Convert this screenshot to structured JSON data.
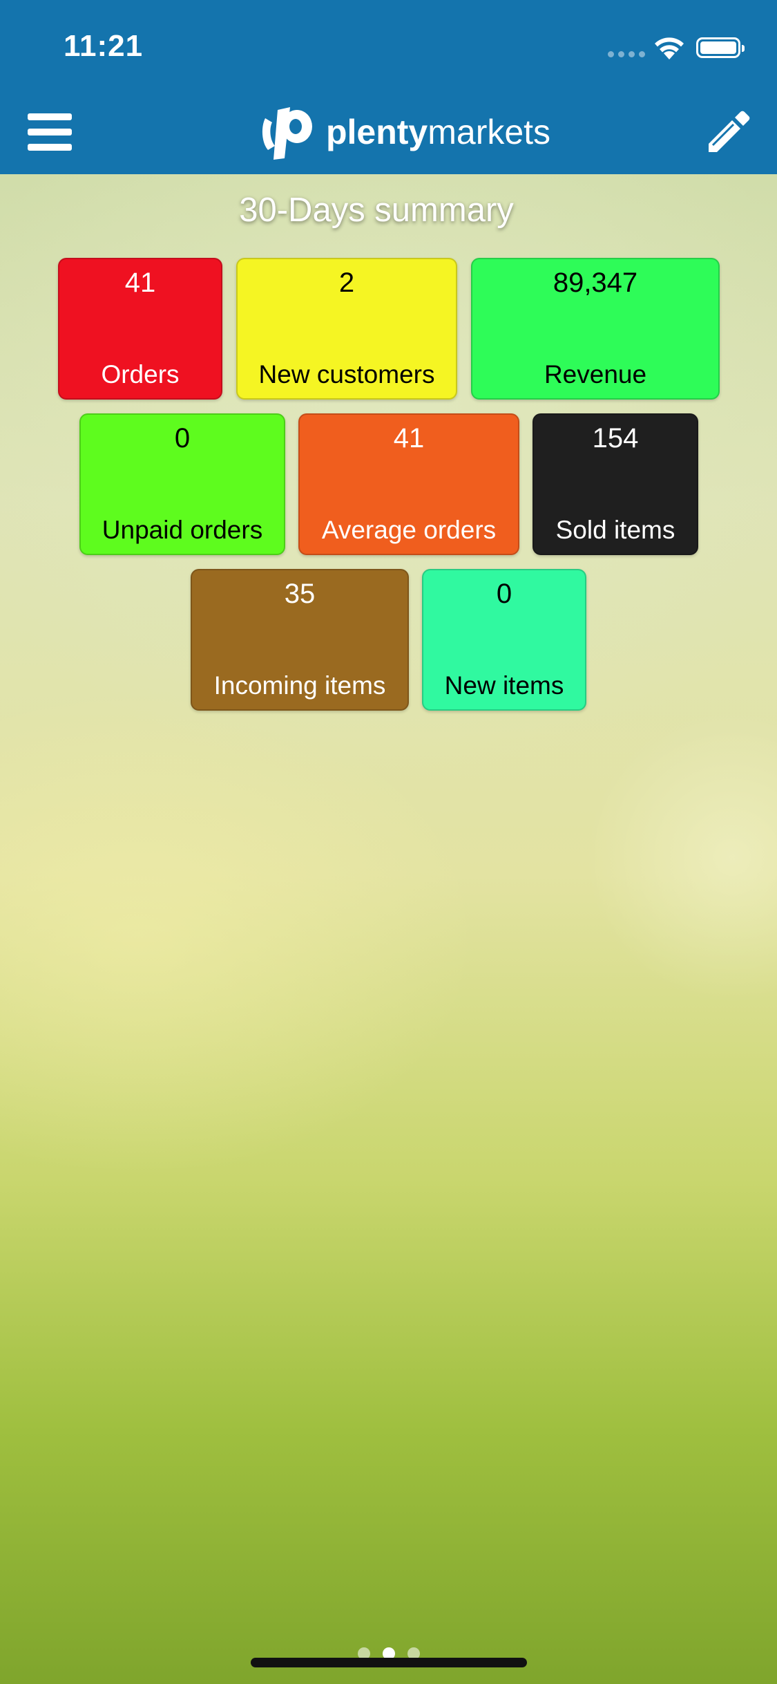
{
  "status_bar": {
    "time": "11:21",
    "icons": [
      "cellular-signal-icon",
      "wifi-icon",
      "battery-icon"
    ]
  },
  "nav_bar": {
    "menu_icon": "hamburger-menu-icon",
    "logo_bold": "plenty",
    "logo_regular": "markets",
    "edit_icon": "pencil-icon",
    "color": "#1474ad"
  },
  "summary": {
    "title": "30-Days summary",
    "tiles": [
      {
        "value": "41",
        "label": "Orders",
        "color": "#ef1121"
      },
      {
        "value": "2",
        "label": "New customers",
        "color": "#f5f523"
      },
      {
        "value": "89,347",
        "label": "Revenue",
        "color": "#2efc58"
      },
      {
        "value": "0",
        "label": "Unpaid orders",
        "color": "#5efc1e"
      },
      {
        "value": "41",
        "label": "Average orders",
        "color": "#f05e1e"
      },
      {
        "value": "154",
        "label": "Sold items",
        "color": "#1f1f1f"
      },
      {
        "value": "35",
        "label": "Incoming items",
        "color": "#9a6a20"
      },
      {
        "value": "0",
        "label": "New items",
        "color": "#30f9a0"
      }
    ]
  },
  "pager": {
    "page_count": 3,
    "active_page": 2
  }
}
